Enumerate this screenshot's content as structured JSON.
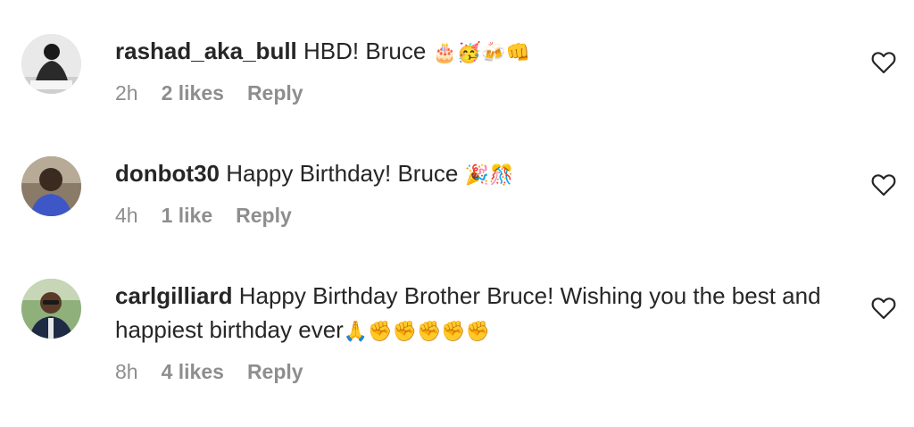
{
  "comments": [
    {
      "username": "rashad_aka_bull",
      "text": "HBD! Bruce",
      "emoji": "🎂🥳🍻👊",
      "time": "2h",
      "likes": "2 likes",
      "reply": "Reply",
      "avatar_icon": "profile-photo"
    },
    {
      "username": "donbot30",
      "text": "Happy Birthday! Bruce",
      "emoji": "🎉🎊",
      "time": "4h",
      "likes": "1 like",
      "reply": "Reply",
      "avatar_icon": "profile-photo"
    },
    {
      "username": "carlgilliard",
      "text": "Happy Birthday Brother Bruce! Wishing you the best and happiest birthday ever",
      "emoji": "🙏✊✊✊✊✊",
      "time": "8h",
      "likes": "4 likes",
      "reply": "Reply",
      "avatar_icon": "profile-photo"
    }
  ],
  "colors": {
    "text": "#262626",
    "meta": "#8e8e8e",
    "background": "#ffffff"
  },
  "icons": {
    "like": "heart-outline-icon"
  }
}
